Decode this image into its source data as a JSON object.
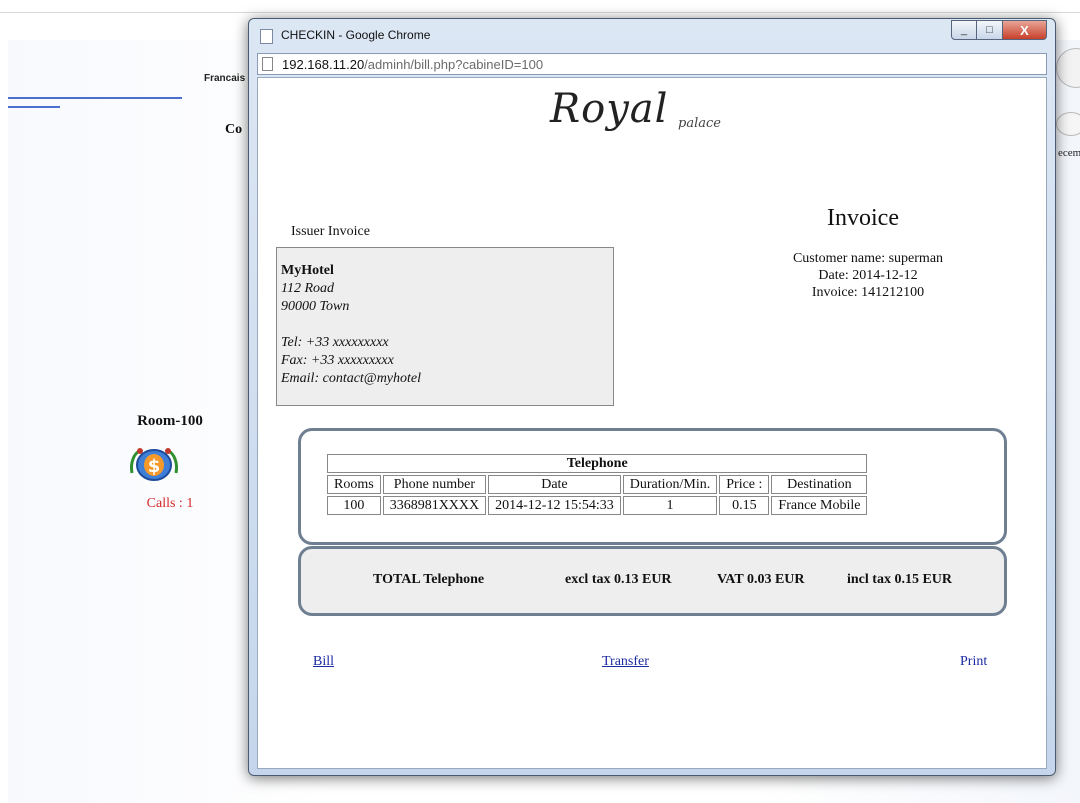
{
  "background": {
    "language_link": "Francais",
    "heading_fragment": "Co",
    "room_label": "Room-100",
    "calls_label": "Calls : 1",
    "date_fragment": "ecem"
  },
  "window": {
    "title": "CHECKIN - Google Chrome",
    "url_host": "192.168.11.20",
    "url_path": "/adminh/bill.php?cabineID=100",
    "minimize_glyph": "_",
    "maximize_glyph": "□",
    "close_glyph": "X"
  },
  "logo": {
    "main": "Royal",
    "sub": "palace"
  },
  "issuer": {
    "label": "Issuer Invoice",
    "name": "MyHotel",
    "address_line1": "112 Road",
    "address_line2": "90000 Town",
    "tel": "Tel: +33 xxxxxxxxx",
    "fax": "Fax: +33 xxxxxxxxx",
    "email": "Email: contact@myhotel"
  },
  "invoice": {
    "title": "Invoice",
    "customer_line": "Customer name:   superman",
    "date_line": "Date:   2014-12-12",
    "number_line": "Invoice: 141212100"
  },
  "telephone_table": {
    "caption": "Telephone",
    "headers": [
      "Rooms",
      "Phone number",
      "Date",
      "Duration/Min.",
      "Price :",
      "Destination"
    ],
    "rows": [
      [
        "100",
        "3368981XXXX",
        "2014-12-12 15:54:33",
        "1",
        "0.15",
        "France Mobile"
      ]
    ]
  },
  "totals": {
    "label": "TOTAL Telephone",
    "excl": "excl tax 0.13 EUR",
    "vat": "VAT 0.03 EUR",
    "incl": "incl tax 0.15 EUR"
  },
  "actions": {
    "bill": "Bill",
    "transfer": "Transfer",
    "print": "Print"
  },
  "colors": {
    "link": "#1b2aa0",
    "calls": "#d62828",
    "frame": "#6f7f92",
    "panel": "#eeeeee"
  }
}
